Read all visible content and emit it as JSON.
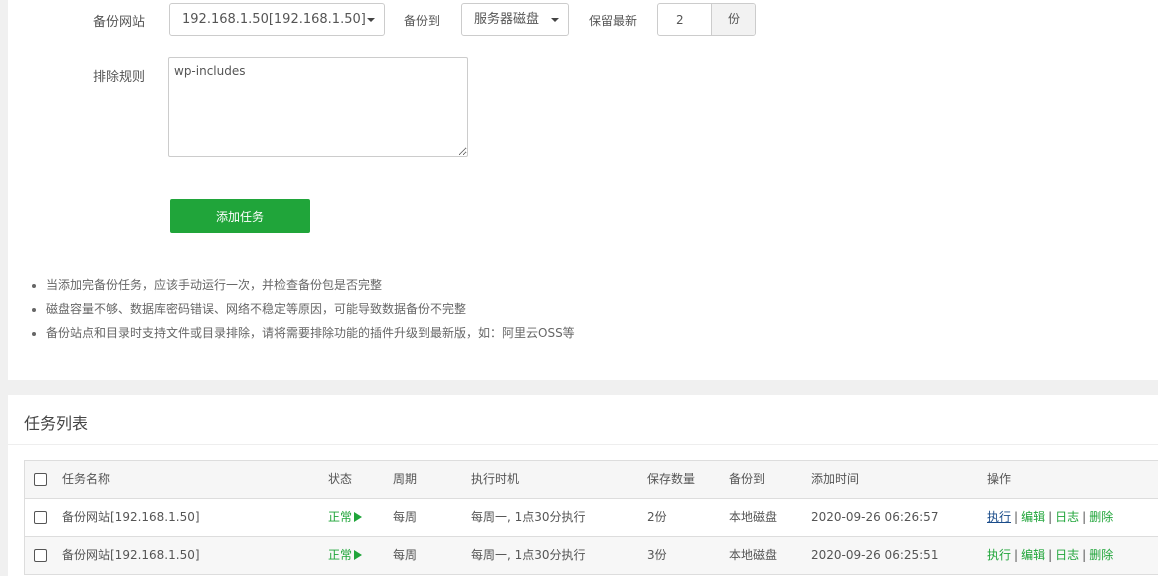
{
  "form": {
    "site_label": "备份网站",
    "site_value": "192.168.1.50[192.168.1.50]",
    "dest_label": "备份到",
    "dest_value": "服务器磁盘",
    "keep_label": "保留最新",
    "keep_value": "2",
    "keep_unit": "份",
    "exclude_label": "排除规则",
    "exclude_value": "wp-includes",
    "add_button": "添加任务"
  },
  "tips": [
    "当添加完备份任务，应该手动运行一次，并检查备份包是否完整",
    "磁盘容量不够、数据库密码错误、网络不稳定等原因，可能导致数据备份不完整",
    "备份站点和目录时支持文件或目录排除，请将需要排除功能的插件升级到最新版，如：阿里云OSS等"
  ],
  "task_list": {
    "title": "任务列表",
    "columns": [
      "任务名称",
      "状态",
      "周期",
      "执行时机",
      "保存数量",
      "备份到",
      "添加时间",
      "操作"
    ],
    "rows": [
      {
        "name": "备份网站[192.168.1.50]",
        "status": "正常",
        "cycle": "每周",
        "timing": "每周一, 1点30分执行",
        "count": "2份",
        "dest": "本地磁盘",
        "added": "2020-09-26 06:26:57"
      },
      {
        "name": "备份网站[192.168.1.50]",
        "status": "正常",
        "cycle": "每周",
        "timing": "每周一, 1点30分执行",
        "count": "3份",
        "dest": "本地磁盘",
        "added": "2020-09-26 06:25:51"
      }
    ],
    "actions": {
      "run": "执行",
      "edit": "编辑",
      "log": "日志",
      "delete": "删除"
    }
  },
  "colors": {
    "accent": "#20a53a",
    "link_visited": "#1a4c8a"
  }
}
